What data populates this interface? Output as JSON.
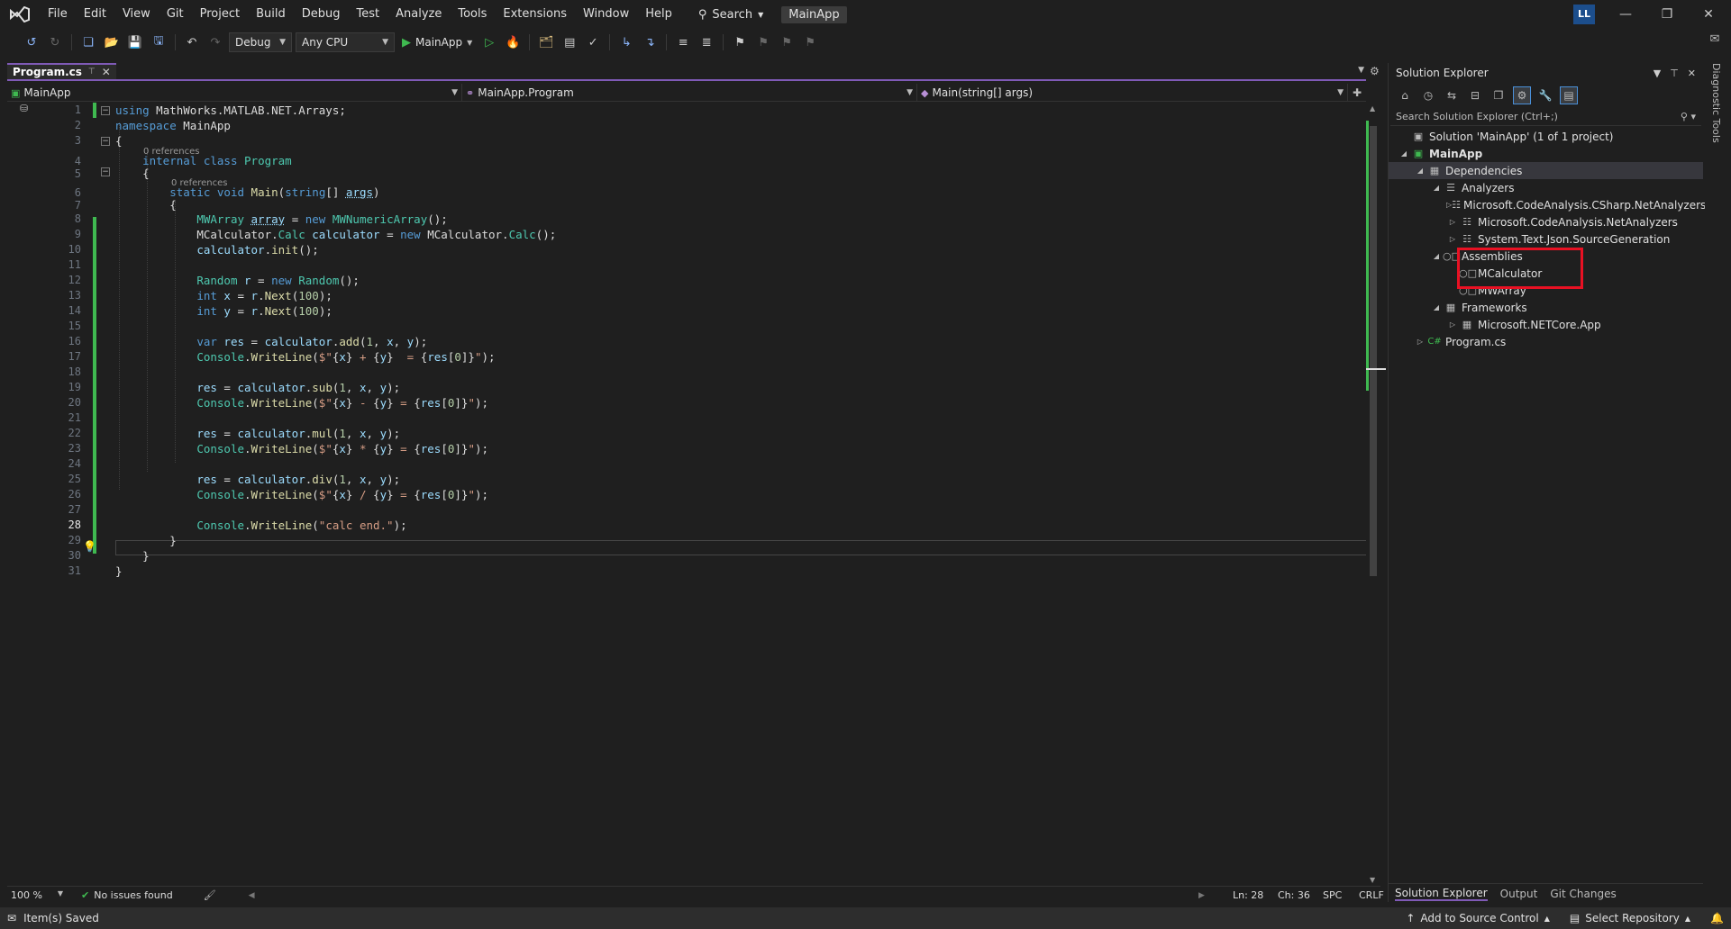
{
  "menubar": {
    "items": [
      "File",
      "Edit",
      "View",
      "Git",
      "Project",
      "Build",
      "Debug",
      "Test",
      "Analyze",
      "Tools",
      "Extensions",
      "Window",
      "Help"
    ],
    "search_label": "Search",
    "solution_name": "MainApp",
    "user_initials": "LL"
  },
  "toolbar": {
    "configuration": "Debug",
    "platform": "Any CPU",
    "run_target": "MainApp"
  },
  "tabs": {
    "active_file": "Program.cs"
  },
  "navbar": {
    "project": "MainApp",
    "type": "MainApp.Program",
    "member": "Main(string[] args)"
  },
  "editor": {
    "line_numbers": [
      "1",
      "2",
      "3",
      "4",
      "5",
      "6",
      "7",
      "8",
      "9",
      "10",
      "11",
      "12",
      "13",
      "14",
      "15",
      "16",
      "17",
      "18",
      "19",
      "20",
      "21",
      "22",
      "23",
      "24",
      "25",
      "26",
      "27",
      "28",
      "29",
      "30",
      "31"
    ],
    "current_line": "28",
    "codelens_class": "0 references",
    "codelens_method": "0 references"
  },
  "status": {
    "zoom": "100 %",
    "issues": "No issues found",
    "line": "Ln: 28",
    "col": "Ch: 36",
    "whitespace": "SPC",
    "eol": "CRLF",
    "message": "Item(s) Saved",
    "source_control": "Add to Source Control",
    "repository": "Select Repository"
  },
  "solution_explorer": {
    "title": "Solution Explorer",
    "search_placeholder": "Search Solution Explorer (Ctrl+;)",
    "tree": {
      "solution": "Solution 'MainApp' (1 of 1 project)",
      "project": "MainApp",
      "dependencies": "Dependencies",
      "analyzers": "Analyzers",
      "analyzer_1": "Microsoft.CodeAnalysis.CSharp.NetAnalyzers",
      "analyzer_2": "Microsoft.CodeAnalysis.NetAnalyzers",
      "analyzer_3": "System.Text.Json.SourceGeneration",
      "assemblies": "Assemblies",
      "assembly_1": "MCalculator",
      "assembly_2": "MWArray",
      "frameworks": "Frameworks",
      "framework_1": "Microsoft.NETCore.App",
      "file_1": "Program.cs"
    },
    "bottom_tabs": [
      "Solution Explorer",
      "Output",
      "Git Changes"
    ]
  },
  "side_panel": {
    "diagnostic_tools": "Diagnostic Tools"
  },
  "colors": {
    "accent": "#7f5ab6",
    "change_bar": "#3fb950",
    "highlight_box": "#e81123",
    "keyword": "#569cd6",
    "type": "#4ec9b0",
    "method": "#dcdcaa",
    "string": "#d69d85",
    "number": "#b5cea8"
  }
}
